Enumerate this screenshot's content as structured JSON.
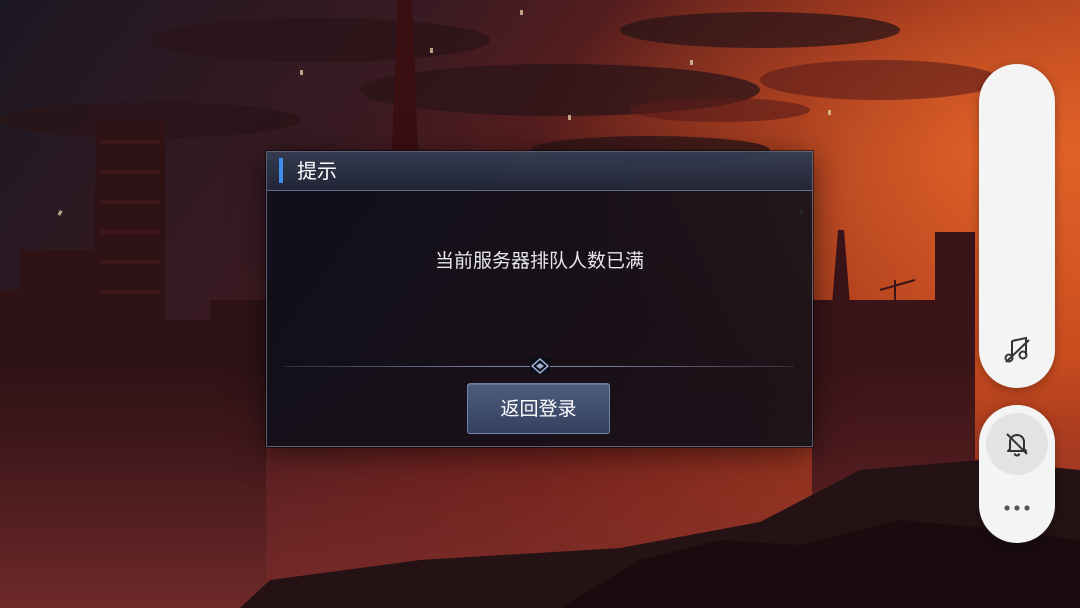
{
  "dialog": {
    "title": "提示",
    "message": "当前服务器排队人数已满",
    "button_label": "返回登录"
  },
  "icons": {
    "music_off": "music-off-icon",
    "notification_off": "bell-off-icon",
    "more": "more-dots-icon"
  },
  "colors": {
    "accent": "#3f8ef0",
    "dialog_bg": "#0a0e18",
    "button_bg": "#3f4c6c",
    "sky": "#8a1f1a"
  }
}
